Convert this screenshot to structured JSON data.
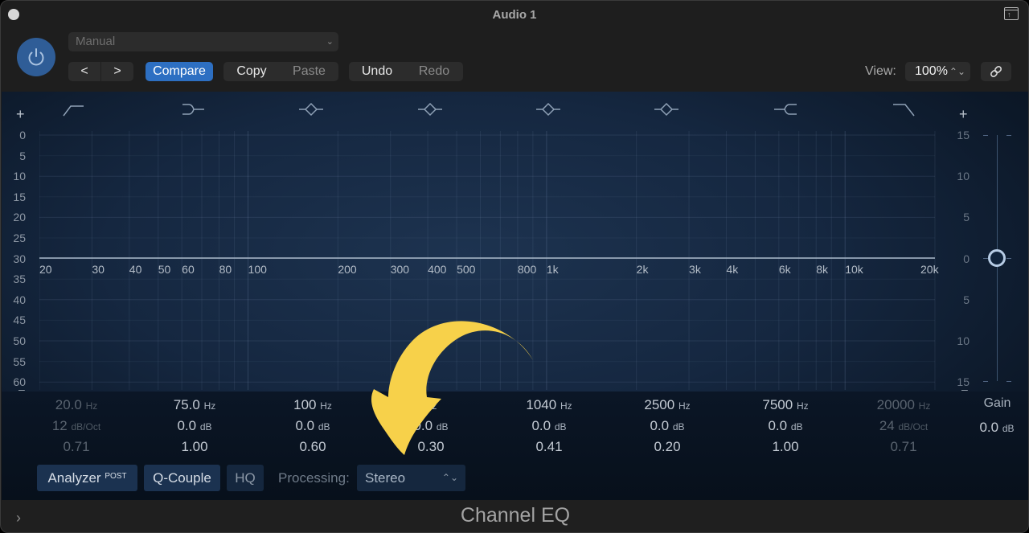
{
  "window": {
    "title": "Audio 1",
    "plugin_name": "Channel EQ"
  },
  "header": {
    "power_state": "on",
    "preset": {
      "value": "Manual"
    },
    "nav": {
      "prev": "<",
      "next": ">"
    },
    "compare_label": "Compare",
    "copy_label": "Copy",
    "paste_label": "Paste",
    "undo_label": "Undo",
    "redo_label": "Redo",
    "view_label": "View:",
    "view_value": "100%"
  },
  "colors": {
    "accent": "#2d6fc2",
    "power": "#2f5d97",
    "annotation_arrow": "#f7d14a"
  },
  "graph": {
    "db_scale_left": [
      "0",
      "5",
      "10",
      "15",
      "20",
      "25",
      "30",
      "35",
      "40",
      "45",
      "50",
      "55",
      "60"
    ],
    "gain_scale_right": [
      "15",
      "10",
      "5",
      "0",
      "5",
      "10",
      "15"
    ],
    "freq_labels": [
      "20",
      "30",
      "40",
      "50",
      "60",
      "80",
      "100",
      "200",
      "300",
      "400",
      "500",
      "800",
      "1k",
      "2k",
      "3k",
      "4k",
      "6k",
      "8k",
      "10k",
      "20k"
    ],
    "freq_values": [
      20,
      30,
      40,
      50,
      60,
      80,
      100,
      200,
      300,
      400,
      500,
      800,
      1000,
      2000,
      3000,
      4000,
      6000,
      8000,
      10000,
      20000
    ],
    "plus_label": "+",
    "minus_label": "–"
  },
  "bands": [
    {
      "type": "low-cut",
      "freq": "20.0",
      "freq_unit": "Hz",
      "gain": "12",
      "gain_unit": "dB/Oct",
      "q": "0.71",
      "enabled": false
    },
    {
      "type": "low-shelf",
      "freq": "75.0",
      "freq_unit": "Hz",
      "gain": "0.0",
      "gain_unit": "dB",
      "q": "1.00",
      "enabled": true
    },
    {
      "type": "bell",
      "freq": "100",
      "freq_unit": "Hz",
      "gain": "0.0",
      "gain_unit": "dB",
      "q": "0.60",
      "enabled": true
    },
    {
      "type": "bell",
      "freq": "",
      "freq_unit": "Hz",
      "gain": "0.0",
      "gain_unit": "dB",
      "q": "0.30",
      "enabled": true
    },
    {
      "type": "bell",
      "freq": "1040",
      "freq_unit": "Hz",
      "gain": "0.0",
      "gain_unit": "dB",
      "q": "0.41",
      "enabled": true
    },
    {
      "type": "bell",
      "freq": "2500",
      "freq_unit": "Hz",
      "gain": "0.0",
      "gain_unit": "dB",
      "q": "0.20",
      "enabled": true
    },
    {
      "type": "high-shelf",
      "freq": "7500",
      "freq_unit": "Hz",
      "gain": "0.0",
      "gain_unit": "dB",
      "q": "1.00",
      "enabled": true
    },
    {
      "type": "high-cut",
      "freq": "20000",
      "freq_unit": "Hz",
      "gain": "24",
      "gain_unit": "dB/Oct",
      "q": "0.71",
      "enabled": false
    }
  ],
  "master_gain": {
    "label": "Gain",
    "value": "0.0",
    "unit": "dB",
    "position_db": 0
  },
  "bottom_bar": {
    "analyzer_label": "Analyzer",
    "analyzer_sup": "POST",
    "qcouple_label": "Q-Couple",
    "hq_label": "HQ",
    "processing_label": "Processing:",
    "processing_value": "Stereo"
  }
}
